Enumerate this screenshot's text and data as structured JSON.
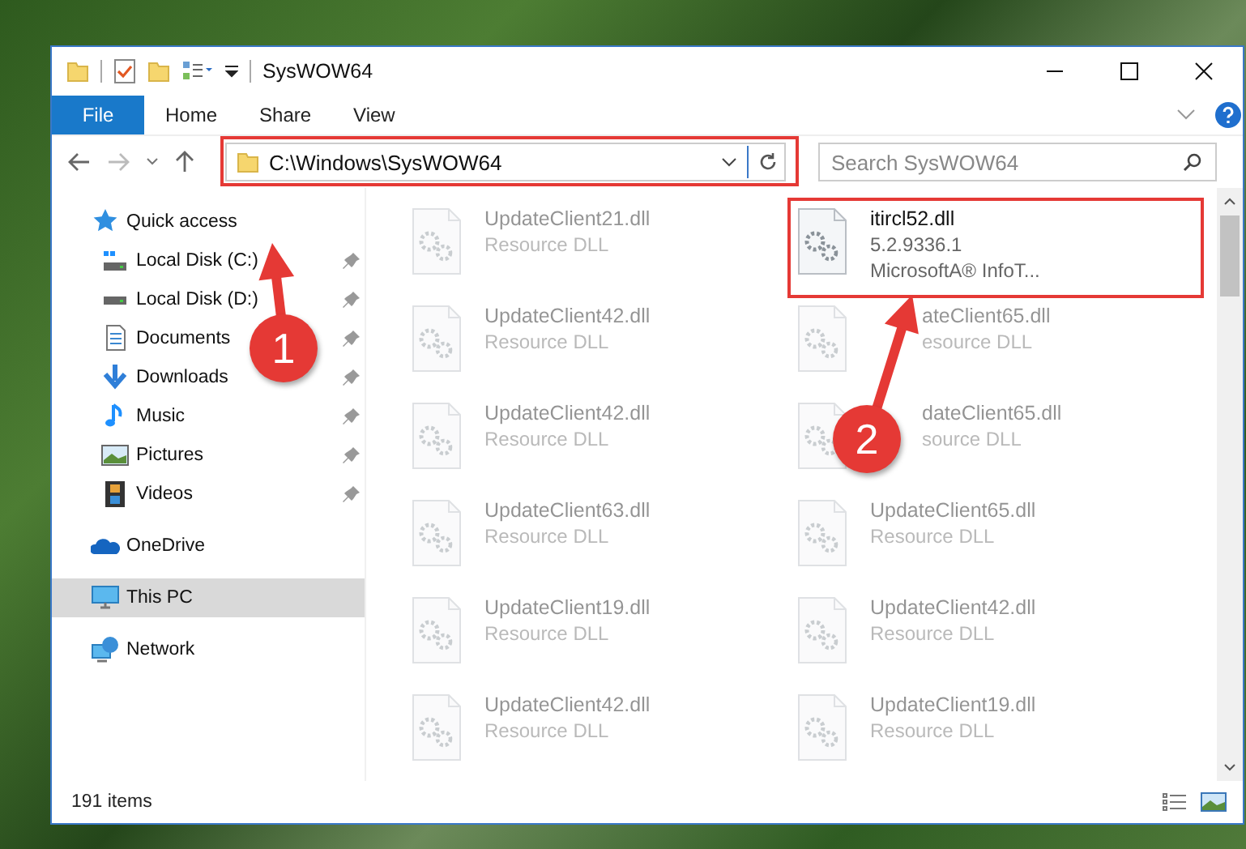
{
  "window": {
    "title": "SysWOW64"
  },
  "ribbon": {
    "tabs": [
      {
        "label": "File",
        "kind": "file"
      },
      {
        "label": "Home",
        "kind": "tab"
      },
      {
        "label": "Share",
        "kind": "tab"
      },
      {
        "label": "View",
        "kind": "tab"
      }
    ]
  },
  "address_bar": {
    "path": "C:\\Windows\\SysWOW64"
  },
  "search": {
    "placeholder": "Search SysWOW64"
  },
  "sidebar": {
    "items": [
      {
        "label": "Quick access",
        "kind": "star",
        "selected": false,
        "children": [
          {
            "label": "Local Disk (C:)",
            "kind": "windrive",
            "pinned": true,
            "selected": false
          },
          {
            "label": "Local Disk (D:)",
            "kind": "drive",
            "pinned": true,
            "selected": false
          },
          {
            "label": "Documents",
            "kind": "document",
            "pinned": true,
            "selected": false
          },
          {
            "label": "Downloads",
            "kind": "download",
            "pinned": true,
            "selected": false
          },
          {
            "label": "Music",
            "kind": "music",
            "pinned": true,
            "selected": false
          },
          {
            "label": "Pictures",
            "kind": "picture",
            "pinned": true,
            "selected": false
          },
          {
            "label": "Videos",
            "kind": "video",
            "pinned": true,
            "selected": false
          }
        ]
      },
      {
        "label": "OneDrive",
        "kind": "cloud",
        "selected": false
      },
      {
        "label": "This PC",
        "kind": "pc",
        "selected": true
      },
      {
        "label": "Network",
        "kind": "network",
        "selected": false
      }
    ]
  },
  "files": [
    {
      "name": "UpdateClient21.dll",
      "details": [
        "Resource DLL"
      ],
      "blurred": true,
      "covered": false
    },
    {
      "name": "itircl52.dll",
      "details": [
        "5.2.9336.1",
        "MicrosoftA® InfoT..."
      ],
      "blurred": false
    },
    {
      "name": "UpdateClient42.dll",
      "details": [
        "Resource DLL"
      ],
      "blurred": true,
      "covered": false
    },
    {
      "name": "ateClient65.dll",
      "details": [
        "esource DLL"
      ],
      "blurred": true,
      "covered": true
    },
    {
      "name": "UpdateClient42.dll",
      "details": [
        "Resource DLL"
      ],
      "blurred": true,
      "covered": false
    },
    {
      "name": "dateClient65.dll",
      "details": [
        "source DLL"
      ],
      "blurred": true,
      "covered": true
    },
    {
      "name": "UpdateClient63.dll",
      "details": [
        "Resource DLL"
      ],
      "blurred": true,
      "covered": false
    },
    {
      "name": "UpdateClient65.dll",
      "details": [
        "Resource DLL"
      ],
      "blurred": true,
      "covered": false
    },
    {
      "name": "UpdateClient19.dll",
      "details": [
        "Resource DLL"
      ],
      "blurred": true,
      "covered": false
    },
    {
      "name": "UpdateClient42.dll",
      "details": [
        "Resource DLL"
      ],
      "blurred": true,
      "covered": false
    },
    {
      "name": "UpdateClient42.dll",
      "details": [
        "Resource DLL"
      ],
      "blurred": true,
      "covered": false
    },
    {
      "name": "UpdateClient19.dll",
      "details": [
        "Resource DLL"
      ],
      "blurred": true,
      "covered": false
    }
  ],
  "status_bar": {
    "item_count": "191 items"
  },
  "annotations": [
    {
      "label": "1"
    },
    {
      "label": "2"
    }
  ]
}
